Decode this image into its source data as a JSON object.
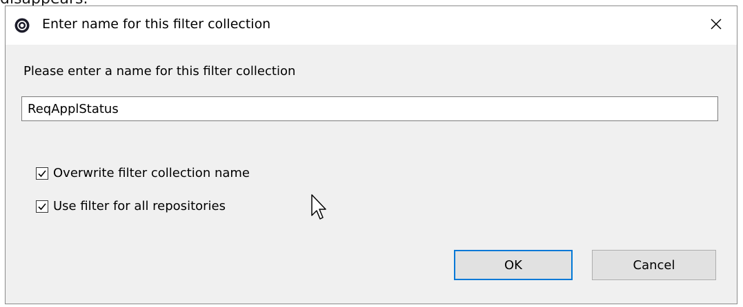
{
  "background_text": "disappears.",
  "dialog": {
    "title": "Enter name for this filter collection",
    "app_icon": "app-logo-icon",
    "close_icon": "close-icon",
    "prompt": "Please enter a name for this filter collection",
    "name_value": "ReqApplStatus",
    "checkboxes": [
      {
        "label": "Overwrite filter collection name",
        "checked": true
      },
      {
        "label": "Use filter for all repositories",
        "checked": true
      }
    ],
    "ok_label": "OK",
    "cancel_label": "Cancel"
  },
  "colors": {
    "dialog_bg": "#f0f0f0",
    "titlebar_bg": "#ffffff",
    "focus_accent": "#0078d7",
    "button_bg": "#e1e1e1"
  }
}
